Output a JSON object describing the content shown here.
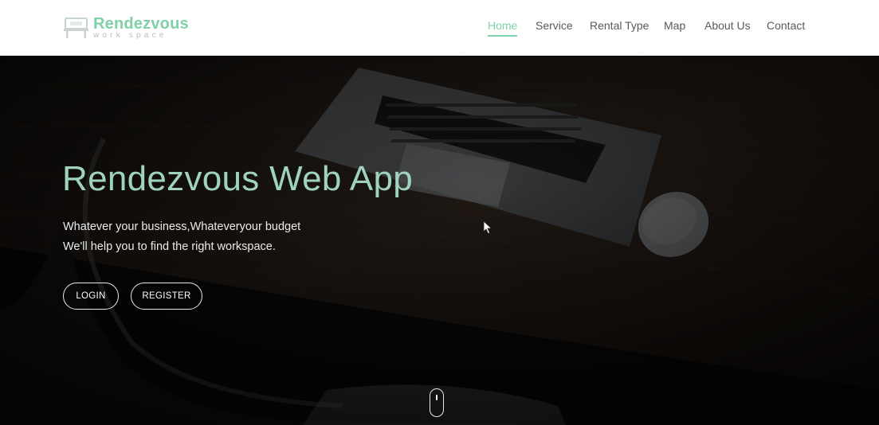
{
  "brand": {
    "name": "Rendezvous",
    "subtitle": "work space"
  },
  "nav": {
    "items": [
      {
        "label": "Home",
        "active": true
      },
      {
        "label": "Service"
      },
      {
        "label": "Rental Type"
      },
      {
        "label": "Map"
      },
      {
        "label": "About Us"
      },
      {
        "label": "Contact"
      }
    ]
  },
  "hero": {
    "title": "Rendezvous Web App",
    "line1": "Whatever your business,Whateveryour budget",
    "line2": "We'll help you to find the right workspace.",
    "login_label": "LOGIN",
    "register_label": "REGISTER"
  },
  "colors": {
    "accent": "#7fd1a7",
    "hero_title": "#9fd3bd",
    "nav_text": "#555b60",
    "header_bg": "#ffffff"
  },
  "icons": {
    "logo": "desk-logo-icon",
    "scroll": "mouse-scroll-icon",
    "cursor": "mouse-pointer-icon"
  }
}
